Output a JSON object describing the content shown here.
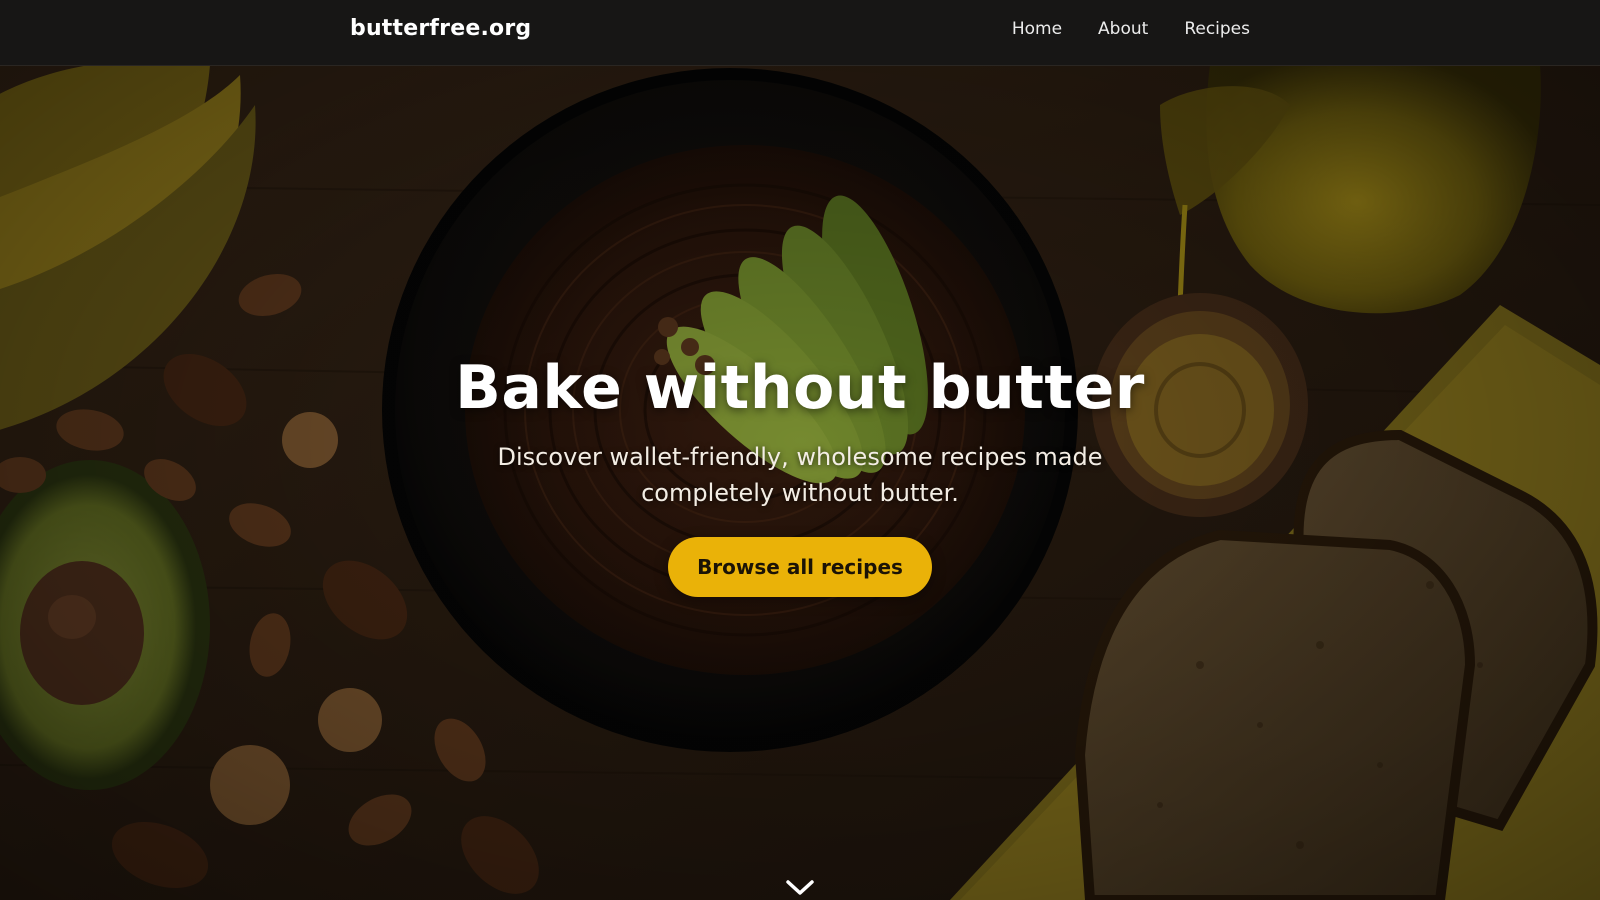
{
  "navbar": {
    "brand": "butterfree.org",
    "links": [
      {
        "label": "Home"
      },
      {
        "label": "About"
      },
      {
        "label": "Recipes"
      }
    ]
  },
  "hero": {
    "title": "Bake without butter",
    "subtitle": "Discover wallet-friendly, wholesome recipes made completely without butter.",
    "cta_label": "Browse all recipes",
    "scroll_icon": "chevron-down-icon"
  },
  "colors": {
    "navbar_bg": "#171615",
    "cta_bg": "#eab208",
    "cta_text": "#1b1306",
    "title_text": "#ffffff",
    "wood_bg": "#3a2616"
  }
}
